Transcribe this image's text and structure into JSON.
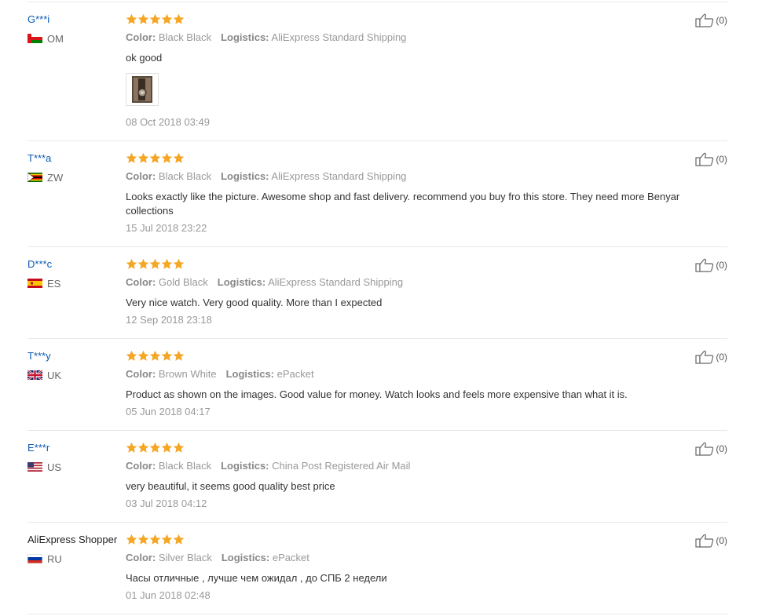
{
  "reviews": [
    {
      "user": "G***i",
      "country": "OM",
      "color_label": "Color:",
      "color": "Black Black",
      "logistics_label": "Logistics:",
      "logistics": "AliExpress Standard Shipping",
      "text": "ok good",
      "date": "08 Oct 2018 03:49",
      "helpful": "(0)",
      "rating": 5,
      "has_photo": true
    },
    {
      "user": "T***a",
      "country": "ZW",
      "color_label": "Color:",
      "color": "Black Black",
      "logistics_label": "Logistics:",
      "logistics": "AliExpress Standard Shipping",
      "text": "Looks exactly like the picture. Awesome shop and fast delivery. recommend you buy fro this store. They need more Benyar collections",
      "date": "15 Jul 2018 23:22",
      "helpful": "(0)",
      "rating": 5
    },
    {
      "user": "D***c",
      "country": "ES",
      "color_label": "Color:",
      "color": "Gold Black",
      "logistics_label": "Logistics:",
      "logistics": "AliExpress Standard Shipping",
      "text": "Very nice watch. Very good quality. More than I expected",
      "date": "12 Sep 2018 23:18",
      "helpful": "(0)",
      "rating": 5
    },
    {
      "user": "T***y",
      "country": "UK",
      "color_label": "Color:",
      "color": "Brown White",
      "logistics_label": "Logistics:",
      "logistics": "ePacket",
      "text": "Product as shown on the images. Good value for money. Watch looks and feels more expensive than what it is.",
      "date": "05 Jun 2018 04:17",
      "helpful": "(0)",
      "rating": 5
    },
    {
      "user": "E***r",
      "country": "US",
      "color_label": "Color:",
      "color": "Black Black",
      "logistics_label": "Logistics:",
      "logistics": "China Post Registered Air Mail",
      "text": "very beautiful, it seems good quality best price",
      "date": "03 Jul 2018 04:12",
      "helpful": "(0)",
      "rating": 5
    },
    {
      "user": "AliExpress Shopper",
      "country": "RU",
      "color_label": "Color:",
      "color": "Silver Black",
      "logistics_label": "Logistics:",
      "logistics": "ePacket",
      "text": "Часы отличные , лучше чем ожидал , до СПБ 2 недели",
      "date": "01 Jun 2018 02:48",
      "helpful": "(0)",
      "rating": 5
    }
  ],
  "colors": {
    "link": "#0a5bb5",
    "star": "#f5a623",
    "muted": "#999999",
    "divider": "#e8e8e8"
  },
  "icons": {
    "rating": "star-icon",
    "helpful": "thumbs-up-icon"
  }
}
